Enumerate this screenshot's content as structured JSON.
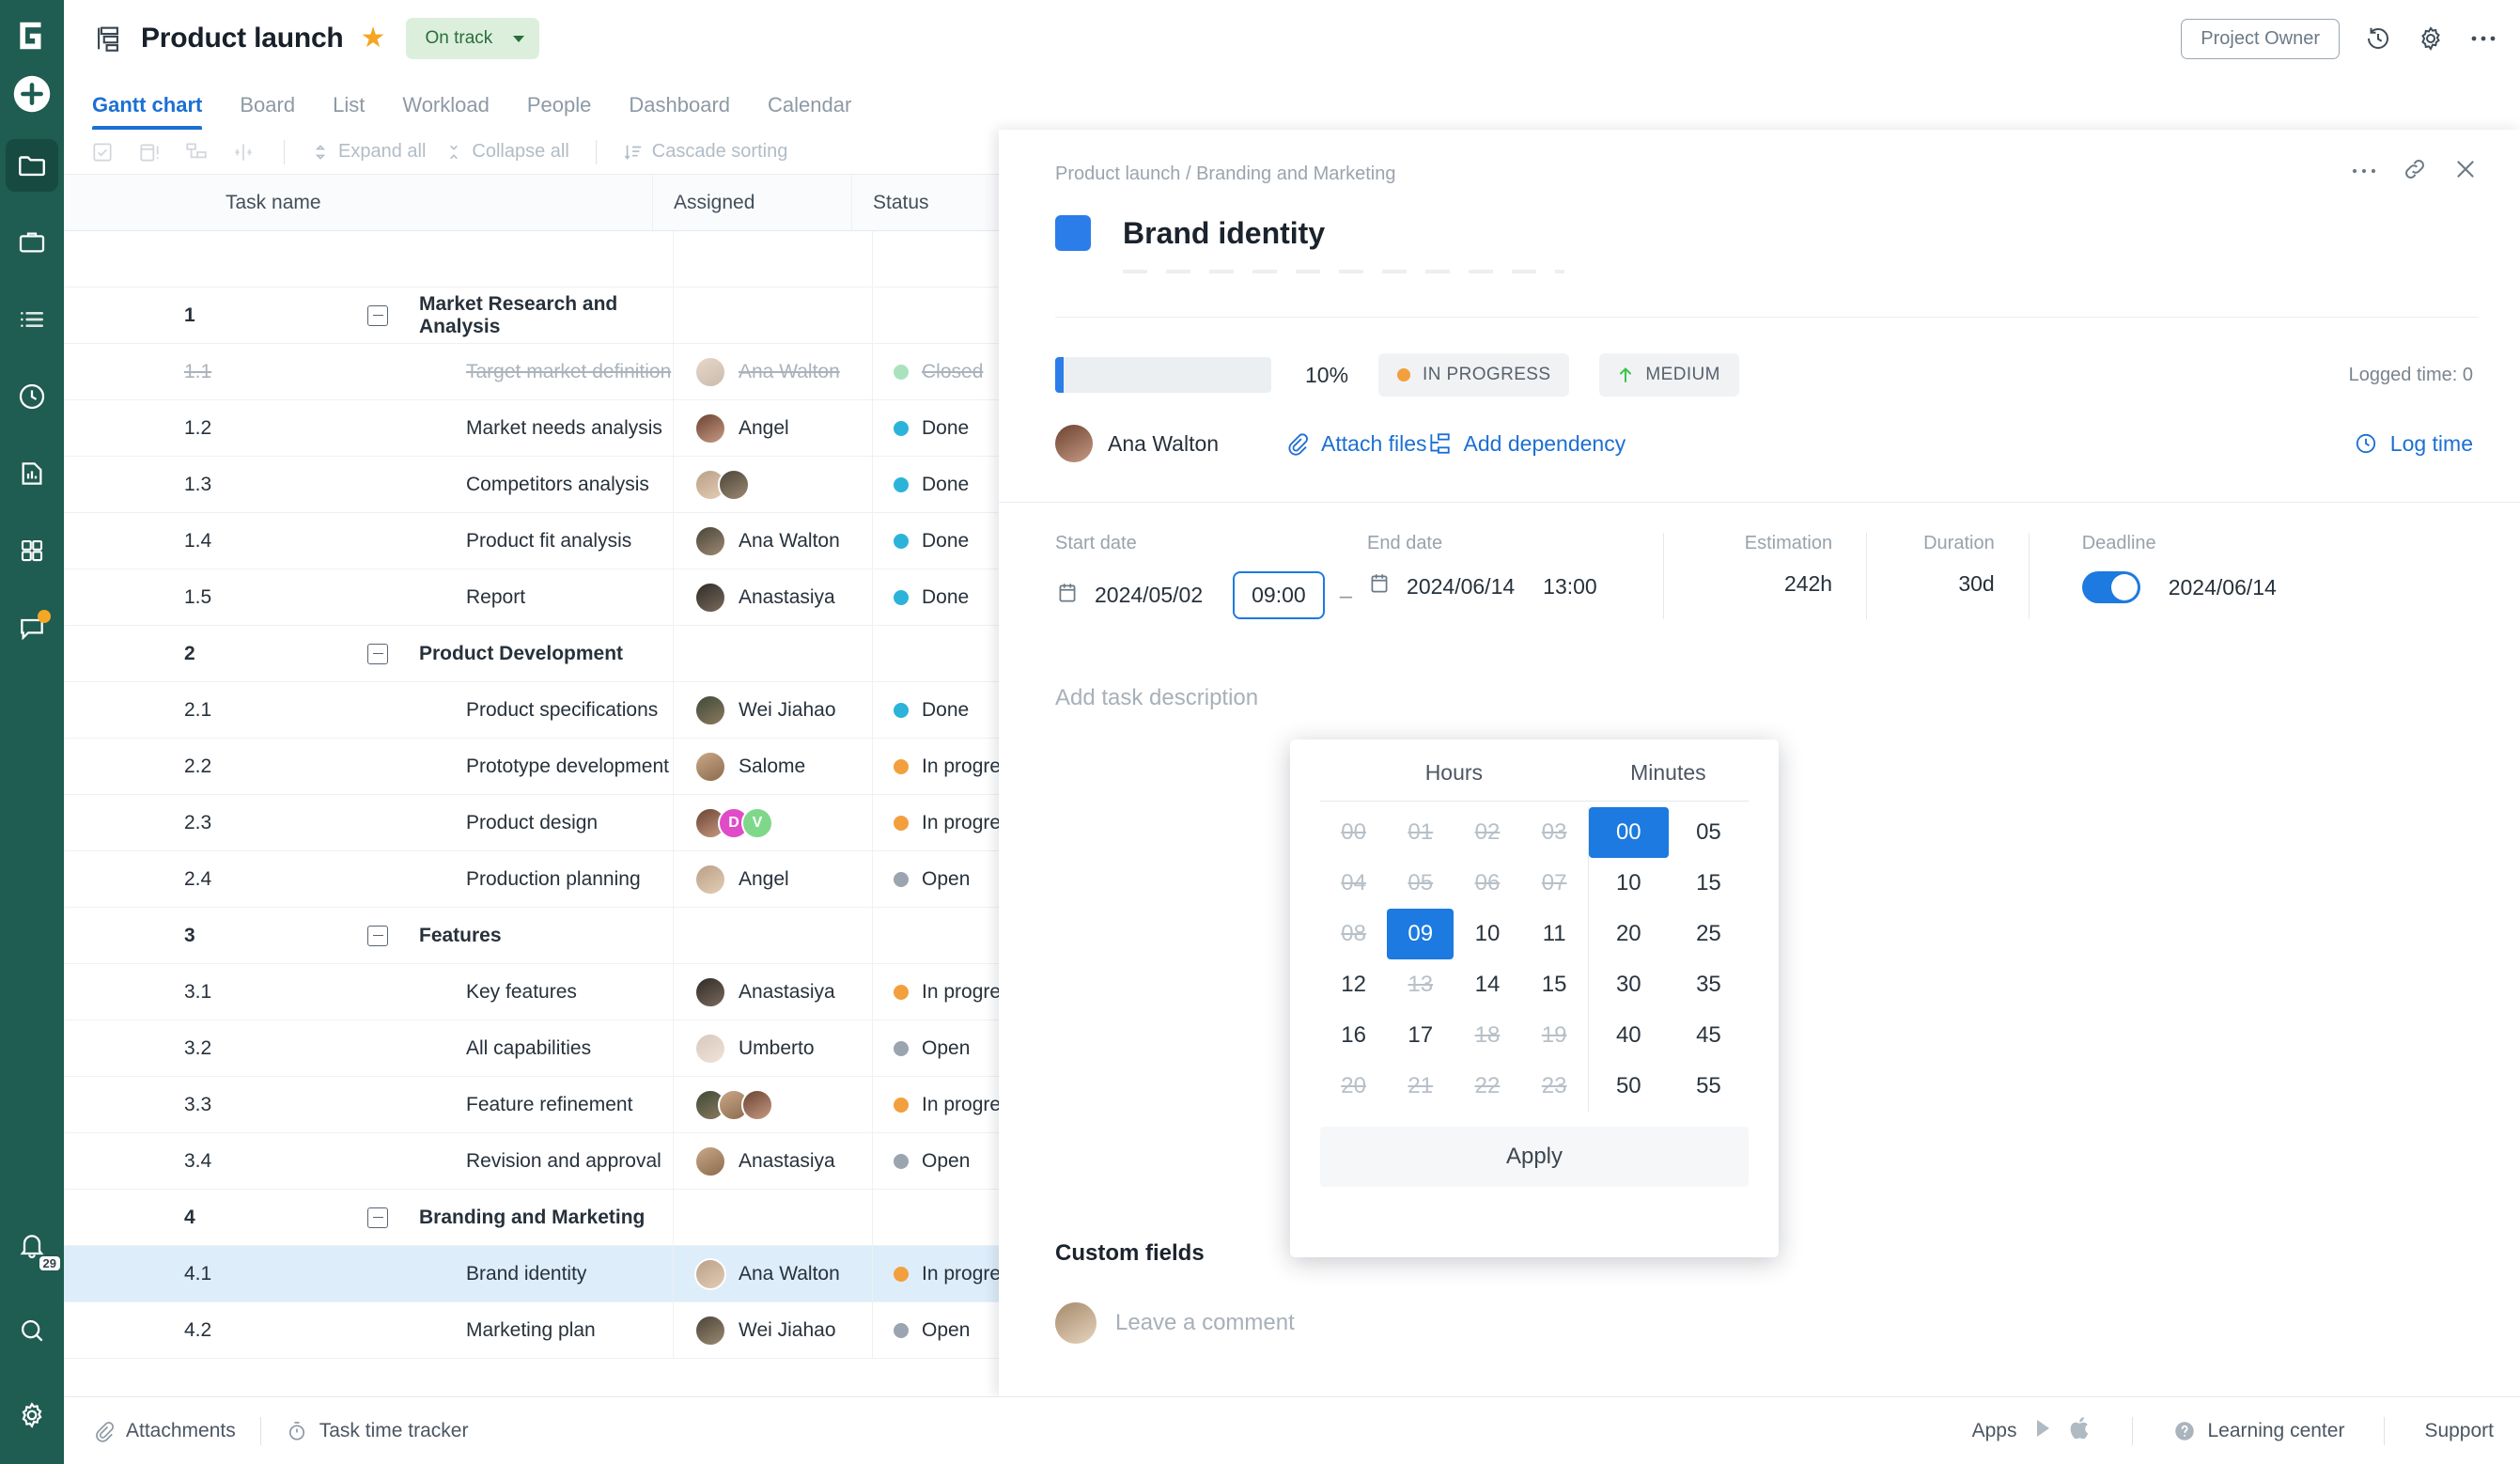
{
  "rail": {
    "logo": "G-logo",
    "add_label": "add-button",
    "items": [
      {
        "name": "projects-icon",
        "active": true
      },
      {
        "name": "briefcase-icon",
        "active": false
      },
      {
        "name": "list-icon",
        "active": false
      },
      {
        "name": "clock-icon",
        "active": false
      },
      {
        "name": "report-icon",
        "active": false
      },
      {
        "name": "apps-grid-icon",
        "active": false
      },
      {
        "name": "chat-icon",
        "active": false,
        "badge": true
      }
    ],
    "bottom": [
      {
        "name": "bell-icon",
        "count": "29"
      },
      {
        "name": "search-icon"
      },
      {
        "name": "settings-icon"
      }
    ]
  },
  "topbar": {
    "project_icon": "project-structure-icon",
    "title": "Product launch",
    "favorite_icon": "star-icon",
    "status": "On track",
    "owner_button": "Project Owner",
    "history_icon": "history-icon",
    "gear_icon": "gear-icon",
    "more_icon": "more-icon"
  },
  "tabs": [
    {
      "label": "Gantt chart",
      "active": true
    },
    {
      "label": "Board",
      "active": false
    },
    {
      "label": "List",
      "active": false
    },
    {
      "label": "Workload",
      "active": false
    },
    {
      "label": "People",
      "active": false
    },
    {
      "label": "Dashboard",
      "active": false
    },
    {
      "label": "Calendar",
      "active": false
    }
  ],
  "toolbar": {
    "icons": [
      "checkbox-icon",
      "calendar-alert-icon",
      "hierarchy-icon",
      "resize-icon"
    ],
    "expand_all": "Expand all",
    "collapse_all": "Collapse all",
    "cascade_sorting": "Cascade sorting"
  },
  "grid": {
    "columns": [
      "",
      "Task name",
      "Assigned",
      "Status",
      ""
    ],
    "rows": [
      {
        "id": "",
        "name": "",
        "assigned": [],
        "status": "",
        "type": "empty"
      },
      {
        "id": "1",
        "name": "Market Research and Analysis",
        "assigned": [],
        "status": "",
        "type": "group"
      },
      {
        "id": "1.1",
        "name": "Target market definition",
        "assigned": [
          "Ana Walton"
        ],
        "status": "Closed",
        "status_color": "#a9e2bd",
        "type": "closed"
      },
      {
        "id": "1.2",
        "name": "Market needs analysis",
        "assigned": [
          "Angel"
        ],
        "status": "Done",
        "status_color": "#2cb3d9",
        "type": "task"
      },
      {
        "id": "1.3",
        "name": "Competitors analysis",
        "assigned": [
          "",
          ""
        ],
        "status": "Done",
        "status_color": "#2cb3d9",
        "type": "task"
      },
      {
        "id": "1.4",
        "name": "Product fit analysis",
        "assigned": [
          "Ana Walton"
        ],
        "status": "Done",
        "status_color": "#2cb3d9",
        "type": "task"
      },
      {
        "id": "1.5",
        "name": "Report",
        "assigned": [
          "Anastasiya"
        ],
        "status": "Done",
        "status_color": "#2cb3d9",
        "type": "task"
      },
      {
        "id": "2",
        "name": "Product Development",
        "assigned": [],
        "status": "",
        "type": "group"
      },
      {
        "id": "2.1",
        "name": "Product specifications",
        "assigned": [
          "Wei Jiahao"
        ],
        "status": "Done",
        "status_color": "#2cb3d9",
        "type": "task"
      },
      {
        "id": "2.2",
        "name": "Prototype development",
        "assigned": [
          "Salome"
        ],
        "status": "In progre",
        "status_color": "#f2a03d",
        "type": "task"
      },
      {
        "id": "2.3",
        "name": "Product design",
        "assigned": [
          "",
          "D",
          "V"
        ],
        "status": "In progre",
        "status_color": "#f2a03d",
        "type": "task"
      },
      {
        "id": "2.4",
        "name": "Production planning",
        "assigned": [
          "Angel"
        ],
        "status": "Open",
        "status_color": "#9aa5b0",
        "type": "task"
      },
      {
        "id": "3",
        "name": "Features",
        "assigned": [],
        "status": "",
        "type": "group"
      },
      {
        "id": "3.1",
        "name": "Key features",
        "assigned": [
          "Anastasiya"
        ],
        "status": "In progre",
        "status_color": "#f2a03d",
        "type": "task"
      },
      {
        "id": "3.2",
        "name": "All capabilities",
        "assigned": [
          "Umberto"
        ],
        "status": "Open",
        "status_color": "#9aa5b0",
        "type": "task"
      },
      {
        "id": "3.3",
        "name": "Feature refinement",
        "assigned": [
          "",
          "",
          ""
        ],
        "status": "In progre",
        "status_color": "#f2a03d",
        "type": "task"
      },
      {
        "id": "3.4",
        "name": "Revision and approval",
        "assigned": [
          "Anastasiya"
        ],
        "status": "Open",
        "status_color": "#9aa5b0",
        "type": "task"
      },
      {
        "id": "4",
        "name": "Branding and Marketing",
        "assigned": [],
        "status": "",
        "type": "group"
      },
      {
        "id": "4.1",
        "name": "Brand identity",
        "assigned": [
          "Ana Walton"
        ],
        "status": "In progre",
        "status_color": "#f2a03d",
        "type": "task",
        "selected": true
      },
      {
        "id": "4.2",
        "name": "Marketing plan",
        "assigned": [
          "Wei Jiahao"
        ],
        "status": "Open",
        "status_color": "#9aa5b0",
        "type": "task"
      }
    ]
  },
  "panel": {
    "breadcrumb": "Product launch / Branding and Marketing",
    "more_icon": "more-icon",
    "link_icon": "copy-link-icon",
    "close_icon": "close-icon",
    "color_swatch": "#2b7de9",
    "title": "Brand identity",
    "progress_pct": "10%",
    "progress_value": 10,
    "status_chip": "IN PROGRESS",
    "priority_chip": "MEDIUM",
    "logged_time": "Logged time: 0",
    "assignee": "Ana Walton",
    "attach_files": "Attach files",
    "add_dependency": "Add dependency",
    "log_time": "Log time",
    "start_date_label": "Start date",
    "start_date": "2024/05/02",
    "start_time": "09:00",
    "end_date_label": "End date",
    "end_date": "2024/06/14",
    "end_time": "13:00",
    "estimation_label": "Estimation",
    "estimation": "242h",
    "duration_label": "Duration",
    "duration": "30d",
    "deadline_label": "Deadline",
    "deadline": "2024/06/14",
    "deadline_on": true,
    "description_placeholder": "Add task description",
    "custom_fields": "Custom fields",
    "comment_placeholder": "Leave a comment"
  },
  "time_picker": {
    "hours_label": "Hours",
    "minutes_label": "Minutes",
    "hours": [
      {
        "v": "00",
        "disabled": true
      },
      {
        "v": "01",
        "disabled": true
      },
      {
        "v": "02",
        "disabled": true
      },
      {
        "v": "03",
        "disabled": true
      },
      {
        "v": "04",
        "disabled": true
      },
      {
        "v": "05",
        "disabled": true
      },
      {
        "v": "06",
        "disabled": true
      },
      {
        "v": "07",
        "disabled": true
      },
      {
        "v": "08",
        "disabled": true
      },
      {
        "v": "09",
        "selected": true
      },
      {
        "v": "10"
      },
      {
        "v": "11"
      },
      {
        "v": "12"
      },
      {
        "v": "13",
        "disabled": true
      },
      {
        "v": "14"
      },
      {
        "v": "15"
      },
      {
        "v": "16"
      },
      {
        "v": "17"
      },
      {
        "v": "18",
        "disabled": true
      },
      {
        "v": "19",
        "disabled": true
      },
      {
        "v": "20",
        "disabled": true
      },
      {
        "v": "21",
        "disabled": true
      },
      {
        "v": "22",
        "disabled": true
      },
      {
        "v": "23",
        "disabled": true
      }
    ],
    "minutes": [
      {
        "v": "00",
        "selected": true
      },
      {
        "v": "05"
      },
      {
        "v": "10"
      },
      {
        "v": "15"
      },
      {
        "v": "20"
      },
      {
        "v": "25"
      },
      {
        "v": "30"
      },
      {
        "v": "35"
      },
      {
        "v": "40"
      },
      {
        "v": "45"
      },
      {
        "v": "50"
      },
      {
        "v": "55"
      }
    ],
    "apply": "Apply"
  },
  "bottom": {
    "attachments": "Attachments",
    "task_time_tracker": "Task time tracker",
    "apps": "Apps",
    "learning_center": "Learning center",
    "support": "Support"
  },
  "colors": {
    "brand_green": "#1f5c51",
    "accent_blue": "#1c6fd4",
    "orange": "#f2a03d",
    "star": "#f5a623"
  }
}
